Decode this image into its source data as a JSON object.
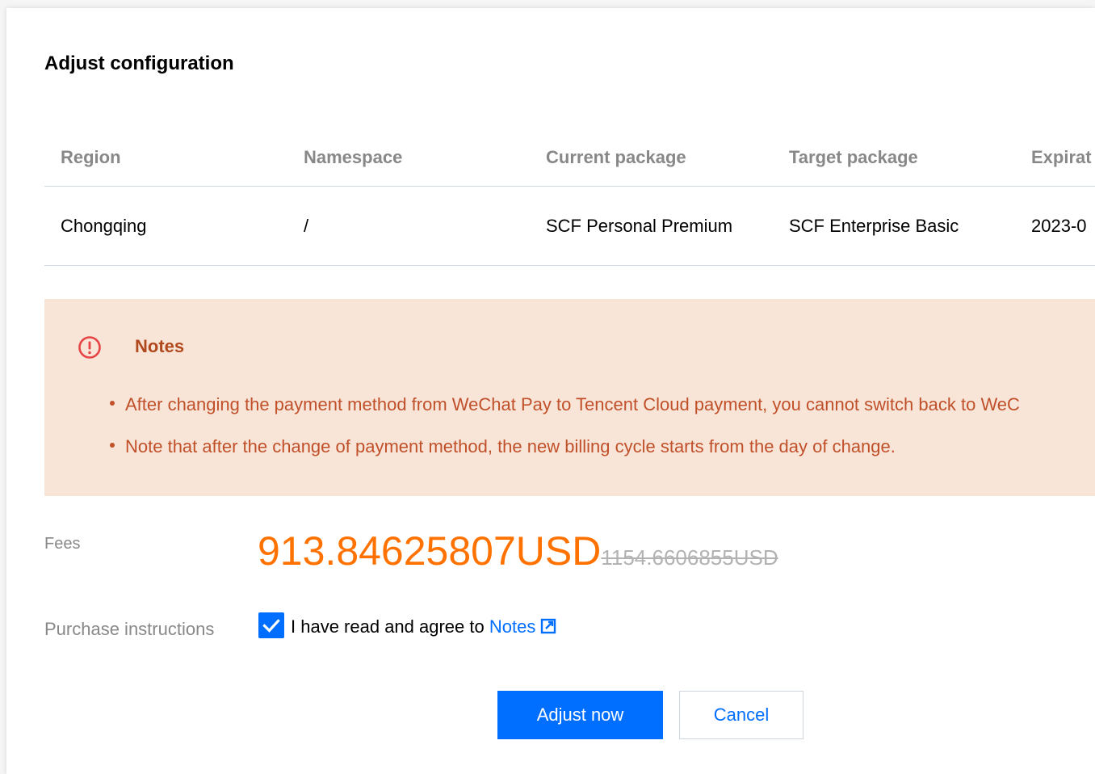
{
  "dialog": {
    "title": "Adjust configuration"
  },
  "table": {
    "headers": [
      "Region",
      "Namespace",
      "Current package",
      "Target package",
      "Expirat"
    ],
    "rows": [
      [
        "Chongqing",
        "/",
        "SCF Personal Premium",
        "SCF Enterprise Basic",
        "2023-0"
      ]
    ]
  },
  "notes": {
    "title": "Notes",
    "icon": "exclamation-circle-icon",
    "items": [
      "After changing the payment method from WeChat Pay to Tencent Cloud payment, you cannot switch back to WeC",
      "Note that after the change of payment method, the new billing cycle starts from the day of change."
    ]
  },
  "fees": {
    "label": "Fees",
    "price": "913.84625807USD",
    "original_price": "1154.6606855USD"
  },
  "purchase": {
    "label": "Purchase instructions",
    "checked": true,
    "agree_text": "I have read and agree to ",
    "link_text": "Notes",
    "link_icon": "external-link-icon"
  },
  "buttons": {
    "adjust_now": "Adjust now",
    "cancel": "Cancel"
  },
  "colors": {
    "accent": "#006eff",
    "price": "#ff7200",
    "notice_bg": "#f9e5d8",
    "notice_text": "#c0502a",
    "danger": "#e54545"
  }
}
